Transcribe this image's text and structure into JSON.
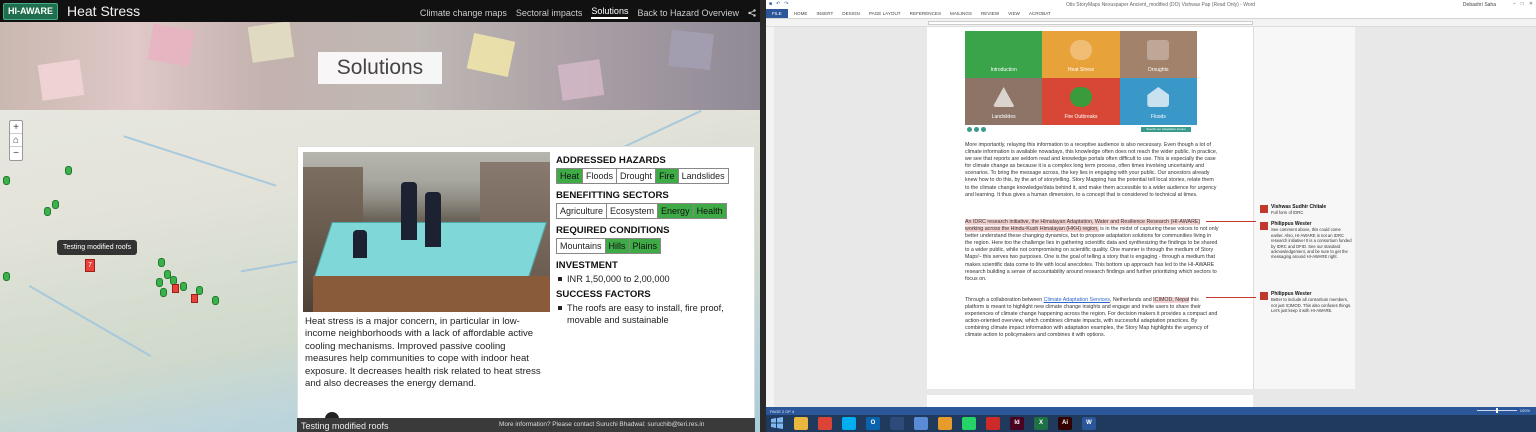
{
  "storymap": {
    "title": "Heat Stress",
    "logo_text": "HI-AWARE",
    "nav": [
      "Climate change maps",
      "Sectoral impacts",
      "Solutions",
      "Back to Hazard Overview"
    ],
    "nav_active": "Solutions",
    "banner_title": "Solutions",
    "map": {
      "tooltip": "Testing modified roofs",
      "active_pin_label": "7",
      "zoom_in": "+",
      "zoom_out": "−",
      "home": "⌂"
    },
    "panel": {
      "body": "Heat stress is a major concern, in particular in low-income neighborhoods with a lack of affordable active cooling mechanisms. Improved passive cooling measures help communities to cope with indoor heat exposure. It decreases health risk related to heat stress and also decreases the energy demand.",
      "addressed_hazards_title": "ADDRESSED HAZARDS",
      "hazards": [
        {
          "label": "Heat",
          "on": true
        },
        {
          "label": "Floods",
          "on": false
        },
        {
          "label": "Drought",
          "on": false
        },
        {
          "label": "Fire",
          "on": true
        },
        {
          "label": "Landslides",
          "on": false
        }
      ],
      "sectors_title": "BENEFITTING SECTORS",
      "sectors": [
        {
          "label": "Agriculture",
          "on": false
        },
        {
          "label": "Ecosystem",
          "on": false
        },
        {
          "label": "Energy",
          "on": true
        },
        {
          "label": "Health",
          "on": true
        }
      ],
      "conditions_title": "REQUIRED CONDITIONS",
      "conditions": [
        {
          "label": "Mountains",
          "on": false
        },
        {
          "label": "Hills",
          "on": true
        },
        {
          "label": "Plains",
          "on": true
        }
      ],
      "investment_title": "INVESTMENT",
      "investment": "INR 1,50,000 to 2,00,000",
      "success_title": "SUCCESS FACTORS",
      "success": "The roofs are easy to install, fire proof, movable and sustainable"
    },
    "footer": {
      "title": "Testing modified roofs",
      "contact": "More information? Please contact Suruchi Bhadwal: suruchib@teri.res.in"
    }
  },
  "word": {
    "window_title": "Otis StoryMaps Nexuspaper Ancient_modified (DO) Vishwas Pap (Read Only) - Word",
    "user": "Debashri Saha",
    "tabs": [
      "FILE",
      "HOME",
      "INSERT",
      "DESIGN",
      "PAGE LAYOUT",
      "REFERENCES",
      "MAILINGS",
      "REVIEW",
      "VIEW",
      "ACROBAT"
    ],
    "tiles": [
      {
        "label": "Introduction",
        "color": "#3aa44a"
      },
      {
        "label": "Heat Stress",
        "color": "#e8a23a"
      },
      {
        "label": "Droughts",
        "color": "#a3826c"
      },
      {
        "label": "Landslides",
        "color": "#8d7466"
      },
      {
        "label": "Fire Outbreaks",
        "color": "#d84735"
      },
      {
        "label": "Floods",
        "color": "#3a98c9"
      }
    ],
    "tile_button": "Search our adaptation stories",
    "para1": "More importantly, relaying this information to a receptive audience is also necessary. Even though a lot of climate information is available nowadays, this knowledge often does not reach the wider public. In practice, we see that reports are seldom read and knowledge portals often difficult to use. This is especially the case for climate change as because it is a complex long term process, often times involving uncertainty and scenarios. To bring the message across, the key lies in engaging with your public. Our ancestors already knew how to do this, by the art of storytelling. Story Mapping has the potential tell local stories, relate them to the climate change knowledge/data behind it, and make them accessible to a wider audience for urgency and learning. It thus gives a human dimension, to a concept that is considered to technical at times.",
    "para2_hl": "An IDRC research initiative, the Himalayan Adaptation, Water and Resilience Research (HI-AWARE) working across the Hindu-Kush Himalayan (HKH) region,",
    "para2": " is in the midst of capturing these voices to not only better understand these changing dynamics, but to propose adaptation solutions for communities living in the region. Here too the challenge lies in gathering scientific data and synthesizing the findings to be shared to a wider public, while not compromising on scientific quality. One manner is through the medium of Story Maps¹- this serves two purposes. One is the goal of telling a story that is engaging - through a medium that makes scientific data come to life with local anecdotes. This bottom up approach has led to the HI-AWARE research building a sense of accountability around research findings and further prioritizing which sectors to focus on.",
    "para3_pre": "Through a collaboration between ",
    "para3_link": "Climate Adaptation Services",
    "para3_mid": ", Netherlands and ",
    "para3_hl": "ICIMOD, Nepal",
    "para3": " this platform is meant to highlight new climate change insights and engage and invite users to share their experiences of climate change happening across the region. For decision makers it provides a compact and action-oriented overview, which combines climate impacts, with successful adaptation practices. By combining climate impact information with adaptation examples, the Story Map highlights the urgency of climate action to policymakers and combines it with options.",
    "comments": [
      {
        "name": "Vishwas Sudhir Chitale",
        "body": "Full form of IDRC"
      },
      {
        "name": "Philippus Wester",
        "body": "See comment above, this could come earlier. Also, HI-AWARE is not an IDRC research initiative! It is a consortium funded by IDRC and DFID. See our standard acknowledgement, and be sure to get the messaging around HI-AWARE right."
      },
      {
        "name": "Philippus Wester",
        "body": "Better to include all consortium members, not just ICIMOD. This also confuses things. Let's just keep it with HI-AWARE."
      }
    ],
    "status_page": "PAGE 2 OF 4",
    "zoom": "100%"
  },
  "taskbar": [
    {
      "name": "windows",
      "label": "",
      "color": "#1f3a5c"
    },
    {
      "name": "explorer",
      "label": "",
      "color": "#e9b73e"
    },
    {
      "name": "chrome",
      "label": "",
      "color": "#db4437"
    },
    {
      "name": "skype",
      "label": "",
      "color": "#00aff0"
    },
    {
      "name": "outlook",
      "label": "O",
      "color": "#0a64ad"
    },
    {
      "name": "arcgis",
      "label": "",
      "color": "#2c4a7a"
    },
    {
      "name": "settings",
      "label": "",
      "color": "#5a8bd6"
    },
    {
      "name": "picasa",
      "label": "",
      "color": "#e59c2a"
    },
    {
      "name": "whatsapp",
      "label": "",
      "color": "#25d366"
    },
    {
      "name": "acrobat",
      "label": "",
      "color": "#cf2a2a"
    },
    {
      "name": "indesign",
      "label": "Id",
      "color": "#49021f"
    },
    {
      "name": "excel",
      "label": "X",
      "color": "#1e7145"
    },
    {
      "name": "illustrator",
      "label": "Ai",
      "color": "#300"
    },
    {
      "name": "word",
      "label": "W",
      "color": "#2b579a"
    }
  ]
}
